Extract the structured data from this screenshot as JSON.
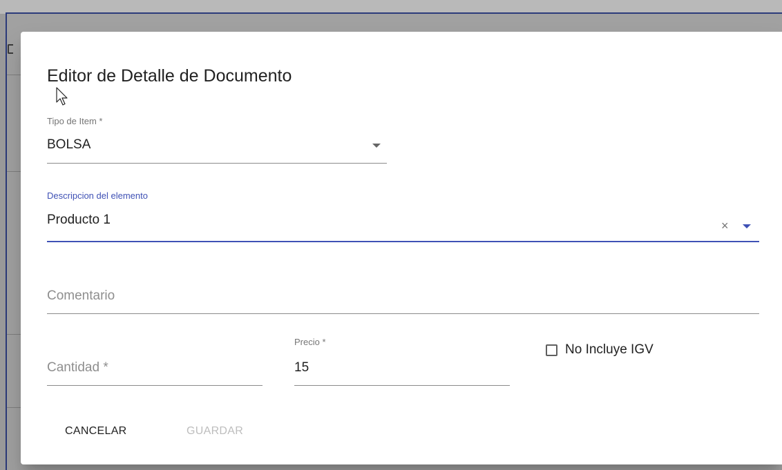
{
  "dialog": {
    "title": "Editor de Detalle de Documento"
  },
  "fields": {
    "item_type": {
      "label": "Tipo de Item *",
      "value": "BOLSA"
    },
    "description": {
      "label": "Descripcion del elemento",
      "value": "Producto 1",
      "clear_glyph": "×"
    },
    "comment": {
      "placeholder": "Comentario"
    },
    "quantity": {
      "placeholder": "Cantidad *"
    },
    "price": {
      "label": "Precio *",
      "value": "15"
    },
    "no_igv": {
      "label": "No Incluye IGV",
      "checked": false
    }
  },
  "actions": {
    "cancel_label": "CANCELAR",
    "save_label": "GUARDAR"
  },
  "colors": {
    "accent": "#3f51b5",
    "disabled_text": "#bdbdbd"
  },
  "icons": {
    "select_arrow": "caret-down-icon",
    "clear": "clear-icon",
    "pointer": "mouse-cursor-icon"
  }
}
